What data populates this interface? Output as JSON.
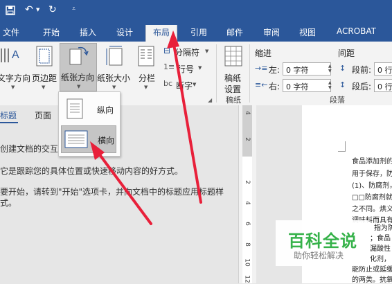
{
  "tabs": [
    "文件",
    "开始",
    "插入",
    "设计",
    "布局",
    "引用",
    "邮件",
    "审阅",
    "视图",
    "ACROBAT"
  ],
  "active_tab": "布局",
  "ribbon": {
    "text_direction": "文字方向",
    "margins": "页边距",
    "orientation": "纸张方向",
    "size": "纸张大小",
    "columns": "分栏",
    "breaks": "分隔符",
    "line_numbers": "行号",
    "hyphenation": "断字",
    "manuscript": "稿纸",
    "manuscript_settings_1": "稿纸",
    "manuscript_settings_2": "设置",
    "manuscript_group": "稿纸",
    "indent_header": "缩进",
    "spacing_header": "间距",
    "left_label": "左:",
    "left_value": "0 字符",
    "right_label": "右:",
    "right_value": "0 字符",
    "before_label": "段前:",
    "before_value": "0 行",
    "after_label": "段后:",
    "after_value": "0 行",
    "paragraph_group": "段落"
  },
  "orientation_menu": {
    "portrait": "纵向",
    "landscape": "横向",
    "selected": "landscape"
  },
  "nav_pane": {
    "tab_headings": "标题",
    "tab_pages": "页面",
    "lines": [
      "创建文档的交互",
      "它是跟踪您的具体位置或快速移动内容的好方式。",
      "要开始，请转到\"开始\"选项卡，并向文档中的标题应用标题样",
      "式。"
    ]
  },
  "ruler_numbers": [
    "4",
    "2",
    "",
    "2",
    "4",
    "6",
    "8",
    "10",
    "12"
  ],
  "document_lines": [
    "食品添加剂的",
    "用于保存，防",
    "(1)、防腐剂，",
    "□□防腐剂就",
    "之不同。烘义",
    "调味料而具有",
    "指为防",
    "；食品",
    "漏酸性",
    "化剂，",
    "能防止或延缓",
    "的两类。抗氧"
  ],
  "watermark": {
    "title": "百科全说",
    "subtitle": "助你轻松解决"
  },
  "colors": {
    "word_blue": "#2b579a",
    "arrow_red": "#e8203a"
  }
}
